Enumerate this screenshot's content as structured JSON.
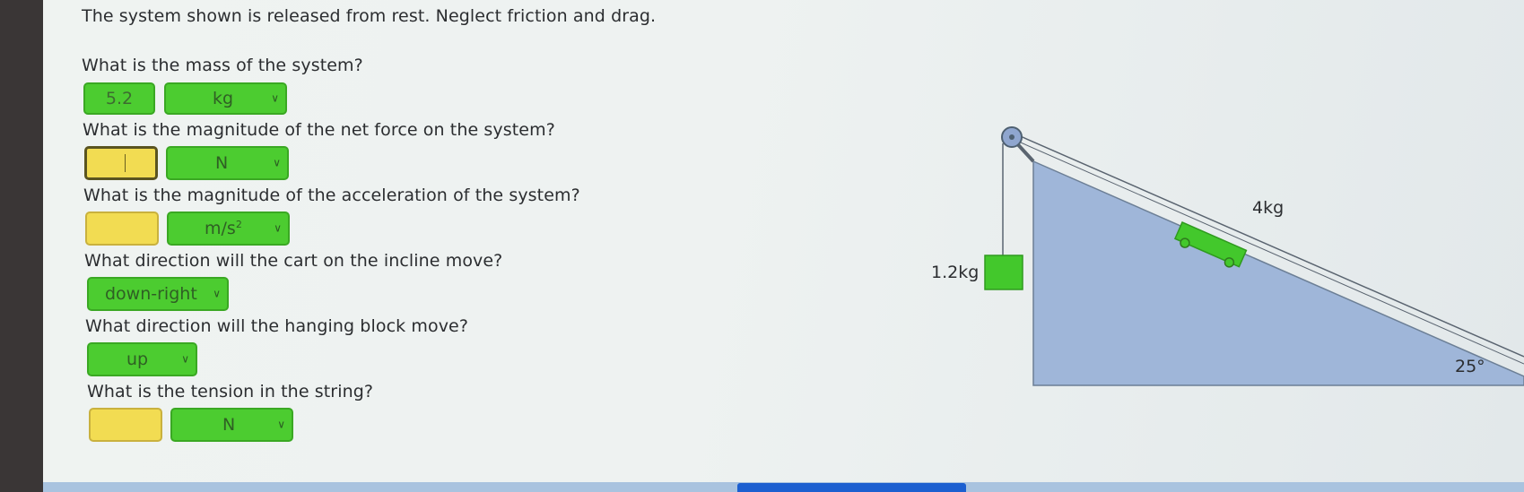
{
  "problem": {
    "intro": "The system shown is released from rest. Neglect friction and drag."
  },
  "questions": {
    "q1": {
      "text": "What is the mass of the system?",
      "value": "5.2",
      "unit": "kg"
    },
    "q2": {
      "text": "What is the magnitude of the net force on the system?",
      "value": "",
      "unit": "N"
    },
    "q3": {
      "text": "What is the magnitude of the acceleration of the system?",
      "value": "",
      "unit_base": "m/s",
      "unit_sup": "2"
    },
    "q4": {
      "text": "What direction will the cart on the incline move?",
      "selected": "down-right"
    },
    "q5": {
      "text": "What direction will the hanging block move?",
      "selected": "up"
    },
    "q6": {
      "text": "What is the tension in the string?",
      "value": "",
      "unit": "N"
    }
  },
  "diagram": {
    "hanging_mass_label": "1.2kg",
    "cart_mass_label": "4kg",
    "angle_label": "25°"
  },
  "colors": {
    "answer_correct": "#4ccc30",
    "answer_empty": "#f2dc52",
    "incline_fill": "#9fb6d9",
    "block_green": "#43c82c"
  },
  "icons": {
    "dropdown": "chevron-down-icon",
    "pulley": "pulley-icon"
  }
}
